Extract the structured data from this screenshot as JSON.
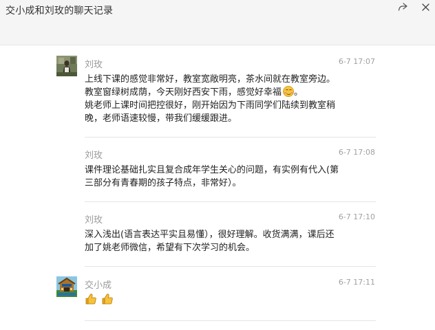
{
  "window": {
    "title": "交小成和刘玫的聊天记录",
    "share_icon": "share-forward-icon",
    "close_icon": "close-icon"
  },
  "messages": [
    {
      "sender": "刘玫",
      "time": "6-7 17:07",
      "lines": [
        "上线下课的感觉非常好，教室宽敞明亮，茶水间就在教室旁边。",
        "教室窗绿树成荫，今天刚好西安下雨，感觉好幸福",
        "姚老师上课时间把控很好，刚开始因为下雨同学们陆续到教室稍",
        "晚，老师语速较慢，带我们缓缓跟进。"
      ],
      "emoji_after_line_2": "smiling-face-emoji",
      "line_2_tail": "。"
    },
    {
      "sender": "刘玫",
      "time": "6-7 17:08",
      "lines": [
        "课件理论基础扎实且复合成年学生关心的问题，有实例有代入(第",
        "三部分有青春期的孩子特点，非常好）。"
      ]
    },
    {
      "sender": "刘玫",
      "time": "6-7 17:10",
      "lines": [
        "深入浅出(语言表达平实且易懂），很好理解。收货满满，课后还",
        "加了姚老师微信，希望有下次学习的机会。"
      ]
    },
    {
      "sender": "交小成",
      "time": "6-7 17:11",
      "emojis": [
        "thumbs-up-emoji",
        "thumbs-up-emoji"
      ]
    }
  ]
}
